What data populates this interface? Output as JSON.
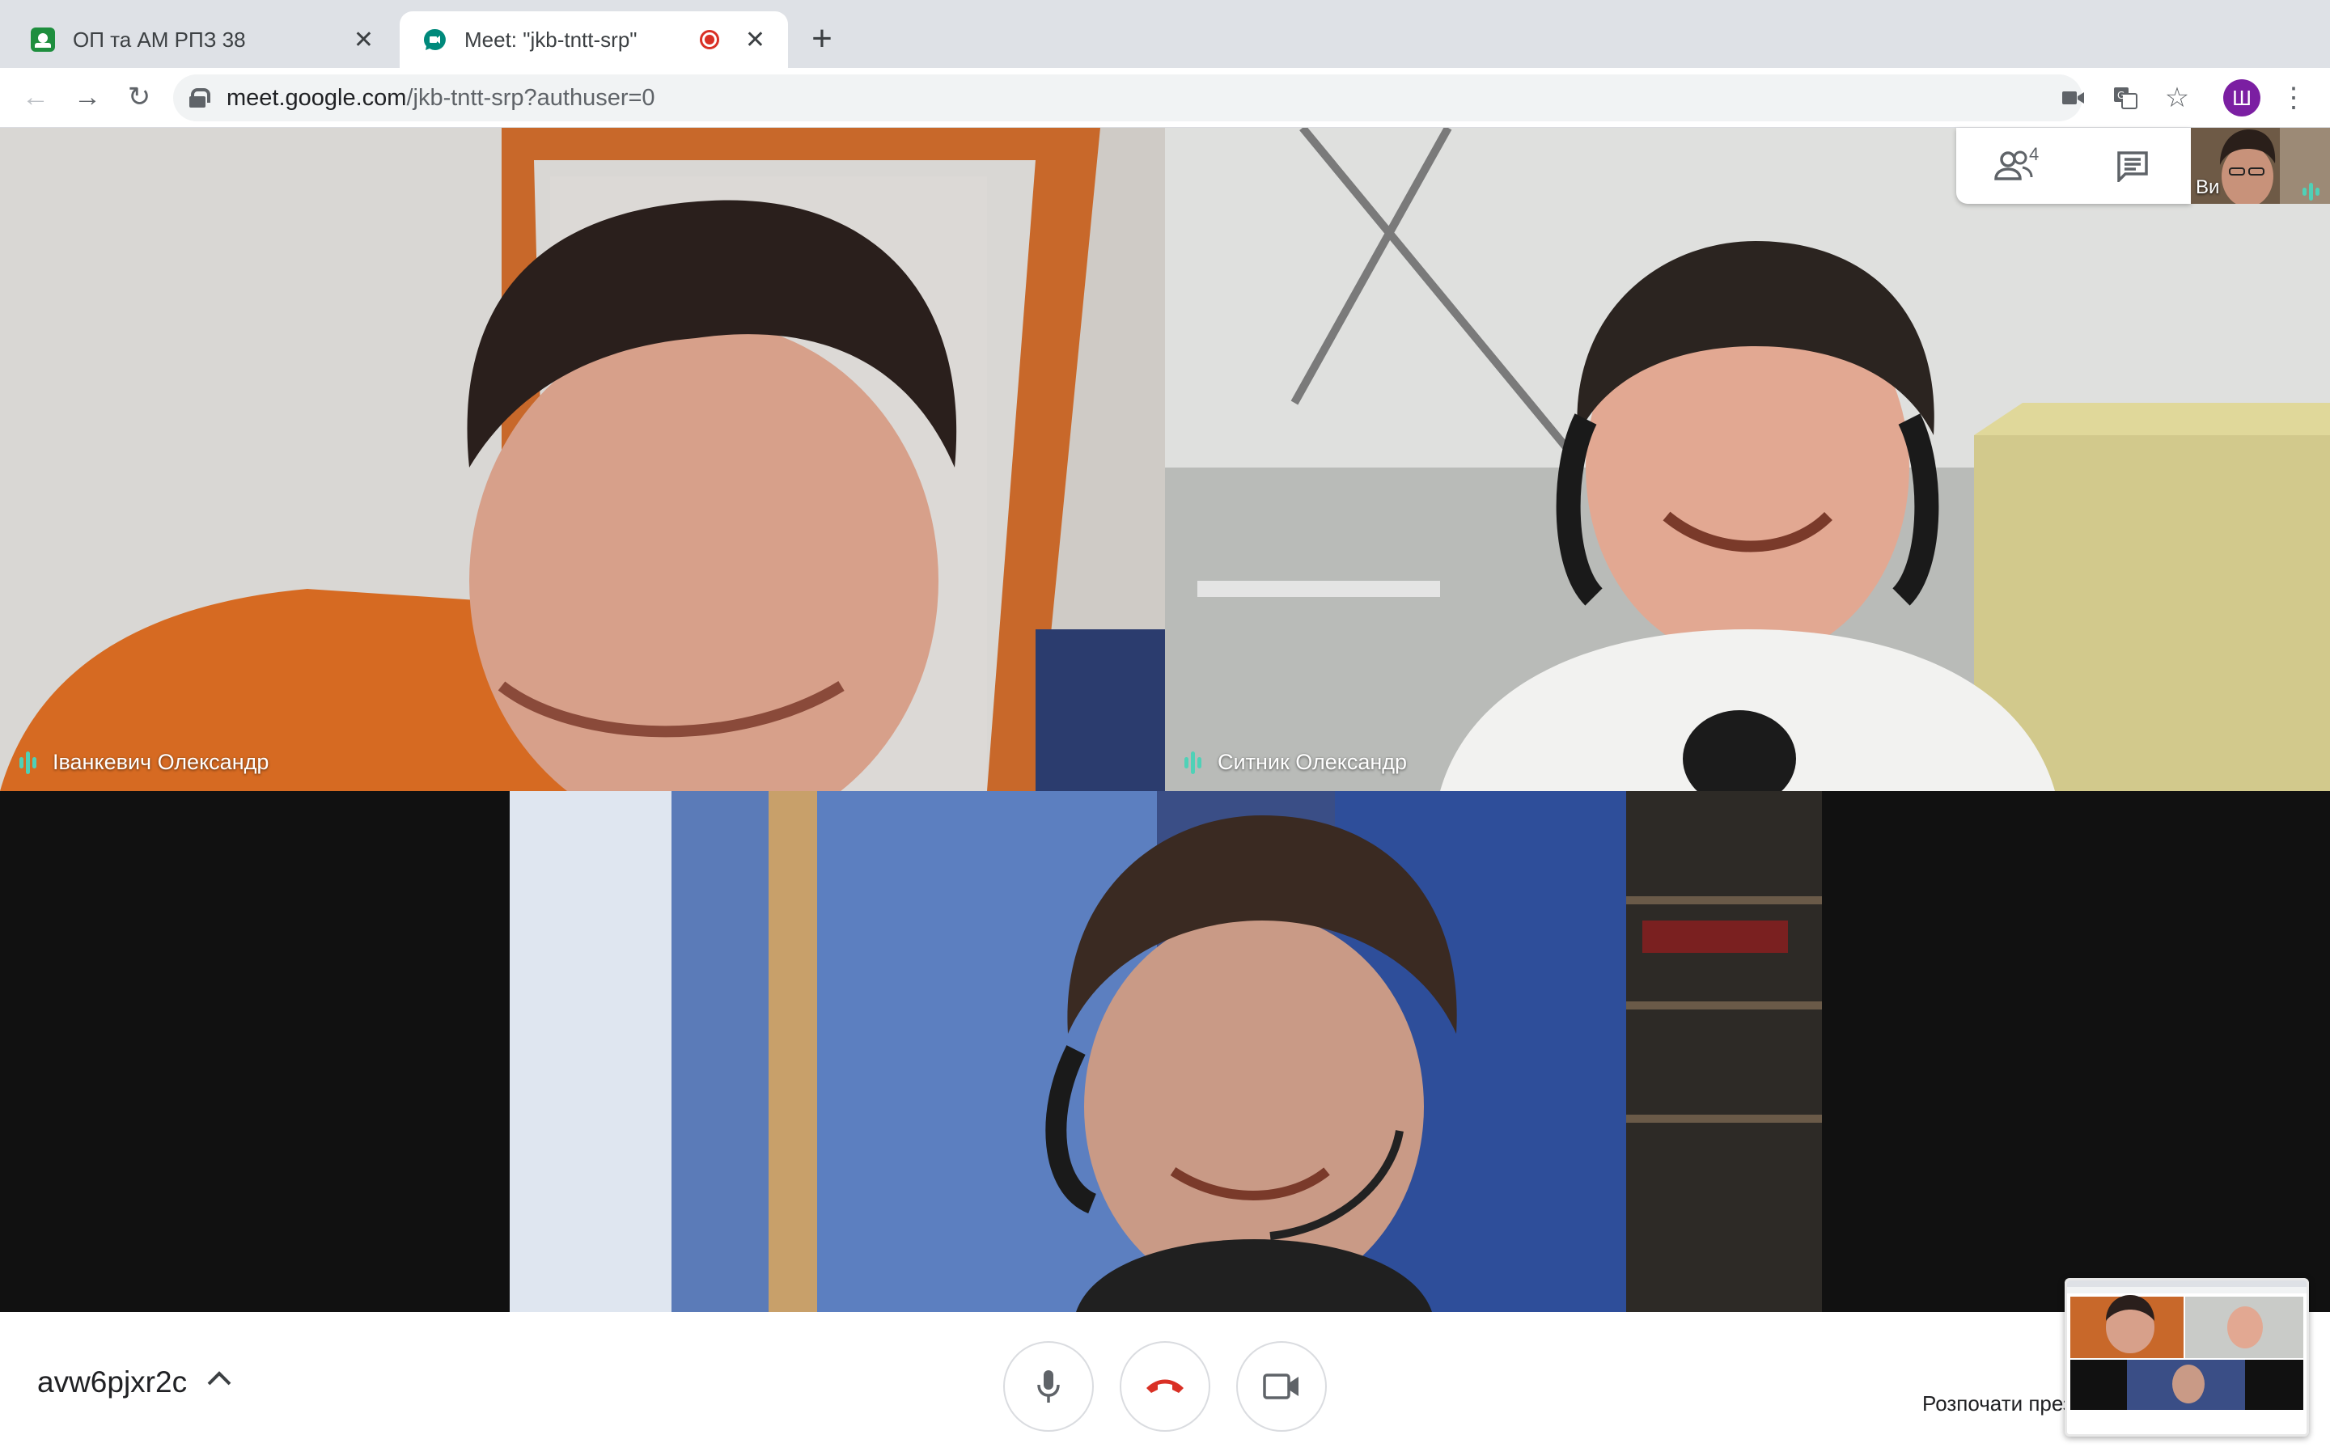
{
  "tabs": [
    {
      "title": "ОП та АМ РПЗ 38",
      "favicon": "google-classroom-icon",
      "active": false
    },
    {
      "title": "Meet: \"jkb-tntt-srp\"",
      "favicon": "google-meet-icon",
      "active": true,
      "recording": true
    }
  ],
  "address_bar": {
    "host": "meet.google.com",
    "path": "/jkb-tntt-srp?authuser=0"
  },
  "profile": {
    "initial": "Ш",
    "color": "#7b1fa2"
  },
  "participants": [
    {
      "name": "Іванкевич Олександр",
      "speaking": true
    },
    {
      "name": "Ситник Олександр",
      "speaking": true
    },
    {
      "name": "",
      "speaking": false
    }
  ],
  "top_panel": {
    "participant_count": "4",
    "self_label": "Ви"
  },
  "meeting": {
    "code": "avw6pjxr2c",
    "present_label": "Розпочати презентацію"
  },
  "colors": {
    "accent_teal": "#4fd1b7",
    "hangup_red": "#d93025",
    "profile_purple": "#7b1fa2"
  }
}
